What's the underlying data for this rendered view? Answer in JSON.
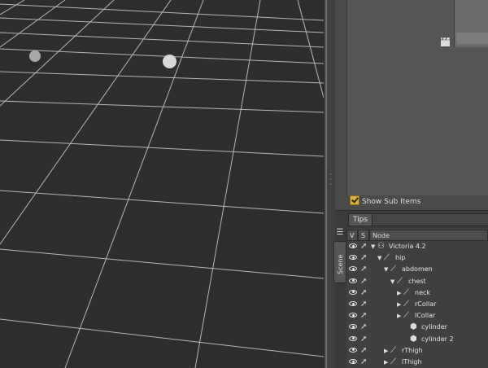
{
  "upper_panel": {
    "show_sub_items_label": "Show Sub Items",
    "show_sub_items_checked": true
  },
  "tips_tab": "Tips",
  "scene_tab": "Scene",
  "columns": {
    "v": "V",
    "s": "S",
    "node": "Node"
  },
  "tree": [
    {
      "label": "Victoria 4.2",
      "icon": "figure-icon",
      "expanded": true
    },
    {
      "label": "hip",
      "icon": "bone-icon",
      "expanded": true
    },
    {
      "label": "abdomen",
      "icon": "bone-icon",
      "expanded": true
    },
    {
      "label": "chest",
      "icon": "bone-icon",
      "expanded": true
    },
    {
      "label": "neck",
      "icon": "bone-icon",
      "expanded": false
    },
    {
      "label": "rCollar",
      "icon": "bone-icon",
      "expanded": false
    },
    {
      "label": "lCollar",
      "icon": "bone-icon",
      "expanded": false
    },
    {
      "label": "cylinder",
      "icon": "prop-icon",
      "expanded": null
    },
    {
      "label": "cylinder 2",
      "icon": "prop-icon",
      "expanded": null
    },
    {
      "label": "rThigh",
      "icon": "bone-icon",
      "expanded": false
    },
    {
      "label": "lThigh",
      "icon": "bone-icon",
      "expanded": false
    }
  ],
  "colors": {
    "viewport_bg": "#2e2e2e",
    "grid": "#d6d6d6",
    "checkbox": "#d8b23a"
  }
}
